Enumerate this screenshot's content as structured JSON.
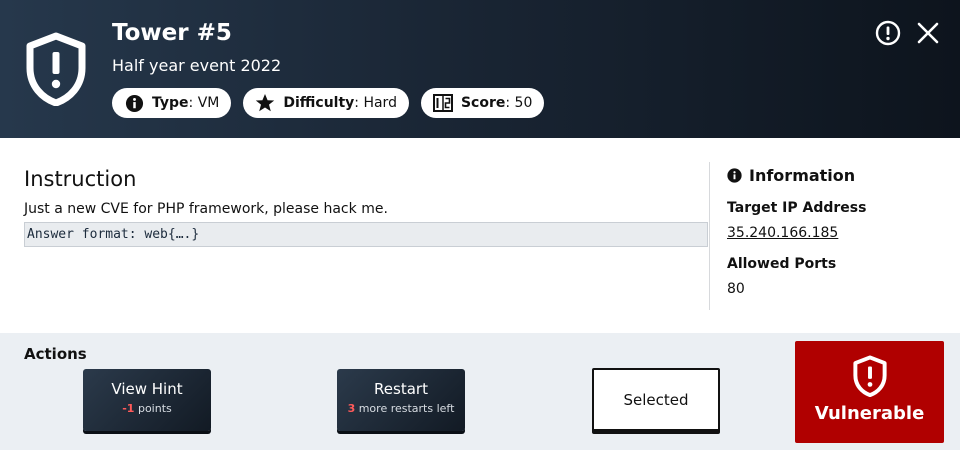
{
  "header": {
    "title": "Tower #5",
    "subtitle": "Half year event 2022",
    "pills": {
      "type": {
        "key": "Type",
        "value": "VM",
        "icon": "info-icon"
      },
      "difficulty": {
        "key": "Difficulty",
        "value": "Hard",
        "icon": "star-icon"
      },
      "score": {
        "key": "Score",
        "value": "50",
        "icon": "scoreboard-icon"
      }
    },
    "icons": {
      "alert": "alert-circle-icon",
      "close": "close-icon",
      "shield": "shield-alert-icon"
    }
  },
  "instruction": {
    "title": "Instruction",
    "text": "Just a new CVE for PHP framework, please hack me.",
    "answer_format": "Answer format: web{….}"
  },
  "information": {
    "title": "Information",
    "target_ip_label": "Target IP Address",
    "target_ip": "35.240.166.185",
    "ports_label": "Allowed Ports",
    "ports": "80"
  },
  "actions": {
    "title": "Actions",
    "view_hint": {
      "label": "View Hint",
      "count": "-1",
      "suffix": " points"
    },
    "restart": {
      "label": "Restart",
      "count": "3",
      "suffix": " more restarts left"
    },
    "selected": {
      "label": "Selected"
    },
    "vulnerable": {
      "label": "Vulnerable"
    }
  },
  "colors": {
    "header_dark": "#1a2635",
    "accent_red": "#b00000",
    "count_red": "#ff5a5a",
    "actions_bg": "#ebeff3"
  }
}
